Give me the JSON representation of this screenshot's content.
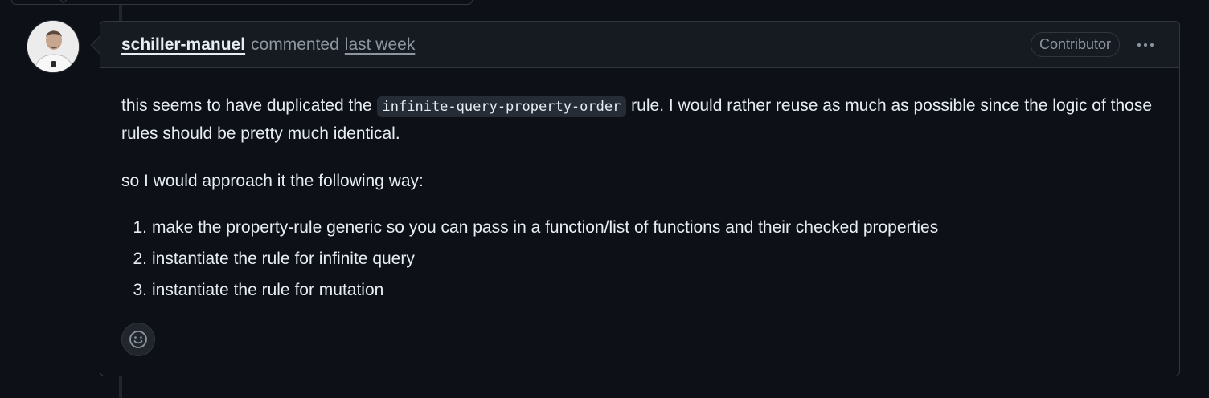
{
  "comment": {
    "author": "schiller-manuel",
    "action": "commented",
    "time": "last week",
    "badge": "Contributor",
    "para1_before": "this seems to have duplicated the ",
    "para1_code": "infinite-query-property-order",
    "para1_after": " rule. I would rather reuse as much as possible since the logic of those rules should be pretty much identical.",
    "para2": "so I would approach it the following way:",
    "steps": [
      {
        "num": "1.",
        "text": "make the property-rule generic so you can pass in a function/list of functions and their checked properties"
      },
      {
        "num": "2.",
        "text": "instantiate the rule for infinite query"
      },
      {
        "num": "3.",
        "text": "instantiate the rule for mutation"
      }
    ]
  },
  "icons": {
    "more": "kebab-horizontal-icon",
    "reaction": "smiley-icon"
  },
  "colors": {
    "background": "#0d1117",
    "header": "#161b22",
    "border": "#30363d",
    "text": "#e6edf3",
    "muted": "#8d96a0"
  }
}
